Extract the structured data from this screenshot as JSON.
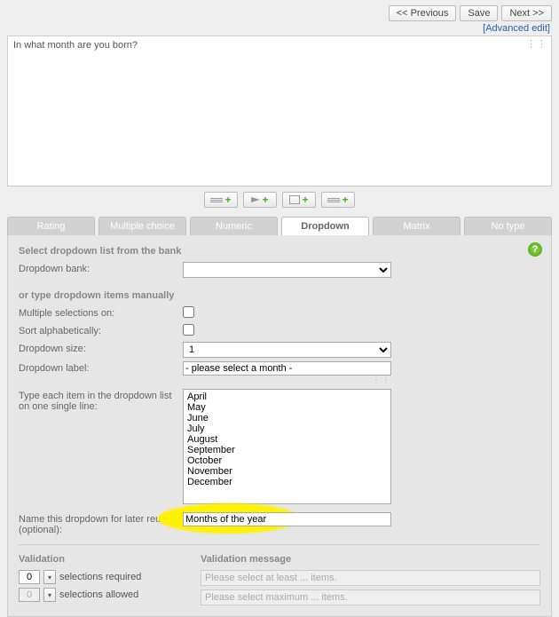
{
  "topbar": {
    "prev": "<< Previous",
    "save": "Save",
    "next": "Next >>"
  },
  "advanced_edit": "[Advanced edit]",
  "question_text": "In what month are you born?",
  "tabs": {
    "rating": "Rating",
    "multiple": "Multiple choice",
    "numeric": "Numeric",
    "dropdown": "Dropdown",
    "matrix": "Matrix",
    "notype": "No type"
  },
  "panel": {
    "bank_title": "Select dropdown list from the bank",
    "bank_label": "Dropdown bank:",
    "bank_value": "",
    "manual_title": "or type dropdown items manually",
    "multi_label": "Multiple selections on:",
    "sort_label": "Sort alphabetically:",
    "size_label": "Dropdown size:",
    "size_value": "1",
    "ddlabel_label": "Dropdown label:",
    "ddlabel_value": "- please select a month -",
    "items_label": "Type each item in the dropdown list on one single line:",
    "items_text": "April\nMay\nJune\nJuly\nAugust\nSeptember\nOctober\nNovember\nDecember",
    "name_label": "Name this dropdown for later reuse (optional):",
    "name_value": "Months of the year",
    "validation_title": "Validation",
    "validation_msg_title": "Validation message",
    "sel_required": "selections required",
    "sel_allowed": "selections allowed",
    "req_value": "0",
    "allow_value": "0",
    "msg_min": "Please select at least ... items.",
    "msg_max": "Please select maximum ... items."
  }
}
